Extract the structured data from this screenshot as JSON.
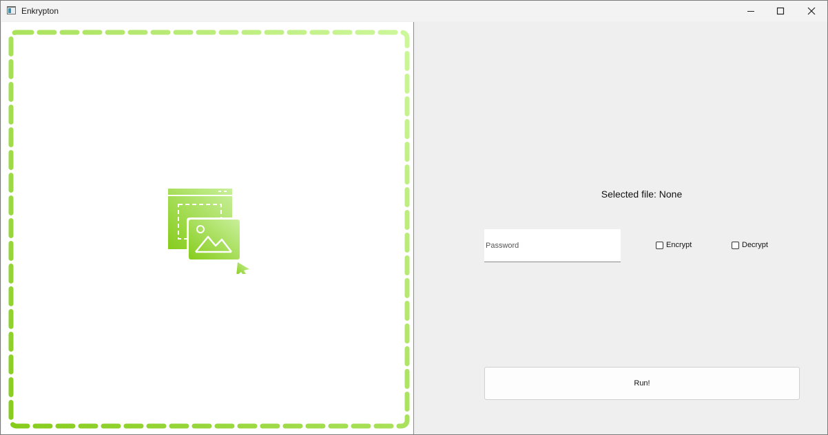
{
  "window": {
    "title": "Enkrypton"
  },
  "drop_zone": {
    "icon": "drag-drop-image-icon",
    "colors": {
      "border_gradient_start": "#cdf79b",
      "border_gradient_end": "#86cc1c",
      "icon_gradient_start": "#c9f09b",
      "icon_gradient_end": "#86cc1c"
    }
  },
  "controls": {
    "selected_file_text": "Selected file: None",
    "password_placeholder": "Password",
    "password_value": "",
    "encrypt_label": "Encrypt",
    "encrypt_checked": false,
    "decrypt_label": "Decrypt",
    "decrypt_checked": false,
    "run_label": "Run!"
  }
}
